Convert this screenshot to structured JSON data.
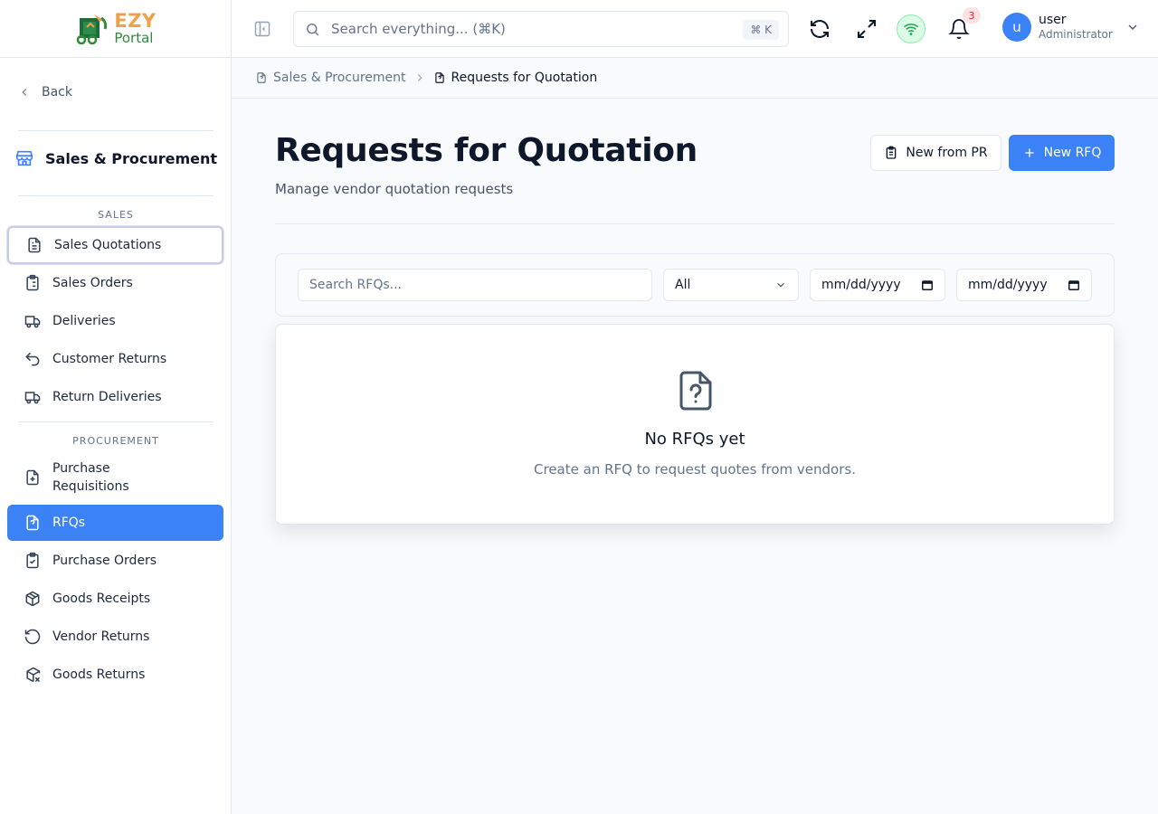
{
  "logo": {
    "brand": "EZY",
    "product": "Portal"
  },
  "sidebar": {
    "back_label": "Back",
    "module_title": "Sales & Procurement",
    "sections": [
      {
        "label": "SALES",
        "items": [
          {
            "label": "Sales Quotations",
            "icon": "file-text-icon"
          },
          {
            "label": "Sales Orders",
            "icon": "clipboard-list-icon"
          },
          {
            "label": "Deliveries",
            "icon": "truck-icon"
          },
          {
            "label": "Customer Returns",
            "icon": "undo-arrow-icon"
          },
          {
            "label": "Return Deliveries",
            "icon": "truck-icon"
          }
        ]
      },
      {
        "label": "PROCUREMENT",
        "items": [
          {
            "label": "Purchase Requisitions",
            "icon": "file-plus-icon"
          },
          {
            "label": "RFQs",
            "icon": "file-question-icon"
          },
          {
            "label": "Purchase Orders",
            "icon": "clipboard-check-icon"
          },
          {
            "label": "Goods Receipts",
            "icon": "package-check-icon"
          },
          {
            "label": "Vendor Returns",
            "icon": "rotate-ccw-icon"
          },
          {
            "label": "Goods Returns",
            "icon": "package-x-icon"
          }
        ]
      }
    ],
    "active_item": "RFQs",
    "focused_item": "Sales Quotations"
  },
  "header": {
    "search_placeholder": "Search everything... (⌘K)",
    "search_shortcut": "⌘ K",
    "notification_count": "3",
    "user_name": "user",
    "user_role": "Administrator",
    "avatar_initial": "u"
  },
  "breadcrumb": {
    "parent": "Sales & Procurement",
    "current": "Requests for Quotation"
  },
  "page": {
    "title": "Requests for Quotation",
    "subtitle": "Manage vendor quotation requests",
    "new_from_pr_label": "New from PR",
    "new_rfq_label": "New RFQ"
  },
  "filters": {
    "search_placeholder": "Search RFQs...",
    "status_value": "All",
    "date_from_placeholder": "mm/dd/yyyy",
    "date_to_placeholder": "mm/dd/yyyy"
  },
  "empty_state": {
    "title": "No RFQs yet",
    "description": "Create an RFQ to request quotes from vendors."
  },
  "colors": {
    "primary": "#3b82f6",
    "logo_orange": "#f0a04b",
    "logo_green": "#2e8b3a",
    "badge_red": "#dc2626"
  }
}
